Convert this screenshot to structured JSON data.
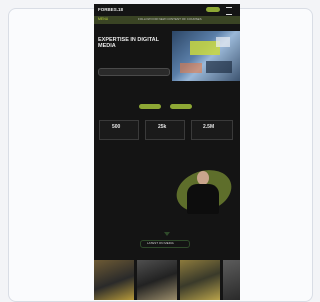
{
  "header": {
    "logo": "FORBES.18",
    "cta": "",
    "menu_icon": "hamburger-icon"
  },
  "nav": {
    "home": "MENU",
    "bar": "FOLLOW FOR NEW CONTENT OF COURSES"
  },
  "hero": {
    "eyebrow": "",
    "title": "EXPERTISE IN DIGITAL MEDIA",
    "subtitle": "",
    "button": ""
  },
  "stats": {
    "label": "",
    "buttons": [
      "",
      ""
    ],
    "items": [
      {
        "value": "500",
        "label": ""
      },
      {
        "value": "25k",
        "label": ""
      },
      {
        "value": "2.5M",
        "label": ""
      }
    ]
  },
  "about": {
    "eyebrow": "",
    "title": "",
    "body": "",
    "link": ""
  },
  "latest": {
    "button": "LATEST ON MEDIA"
  },
  "colors": {
    "accent": "#b8d33c",
    "background": "#141414"
  }
}
